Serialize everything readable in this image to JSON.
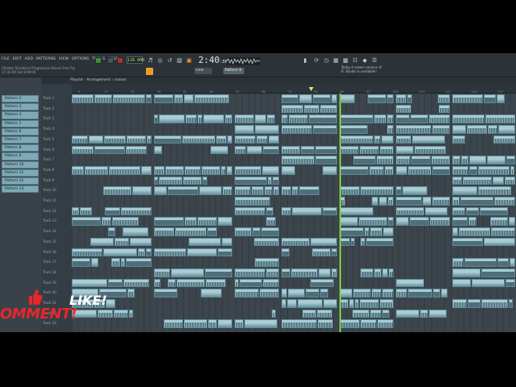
{
  "app": {
    "menu": [
      "FILE",
      "EDIT",
      "ADD",
      "PATTERNS",
      "VIEW",
      "OPTIONS",
      "TOOLS",
      "HELP"
    ],
    "project_line1": "(Vladan Simdelar) Progressive House Free Flp",
    "project_line2": "17:31:00 Sat 8:00:00",
    "tempo": "128.000",
    "time": "2:40",
    "time_sub": ":36",
    "pattern_button": "Pattern 8",
    "hint_line1": "Today  A newer version of",
    "hint_line2": "FL Studio is available!",
    "snap": "Line"
  },
  "playlist": {
    "title": "Playlist - Arrangement › (none)",
    "ruler": [
      "9",
      "17",
      "25",
      "33",
      "41",
      "49",
      "57",
      "65",
      "73",
      "81",
      "89",
      "97",
      "105",
      "113",
      "121",
      "129",
      "137"
    ],
    "tracks": [
      "Track 1",
      "Track 2",
      "Track 3",
      "Track 4",
      "Track 5",
      "Track 6",
      "Track 7",
      "Track 8",
      "Track 9",
      "Track 10",
      "Track 11",
      "Track 12",
      "Track 13",
      "Track 14",
      "Track 15",
      "Track 16",
      "Track 17",
      "Track 18",
      "Track 19",
      "Track 20",
      "Track 21",
      "Track 22",
      "Track 23"
    ]
  },
  "channels": [
    "Pattern 2",
    "Pattern 3",
    "Pattern 4",
    "Pattern 5",
    "Pattern 6",
    "Pattern 7",
    "Pattern 8",
    "Pattern 9",
    "Pattern 10",
    "Pattern 11",
    "Pattern 12",
    "Pattern 13"
  ],
  "overlay": {
    "like": "LIKE!",
    "comment": "OMMENT!"
  }
}
